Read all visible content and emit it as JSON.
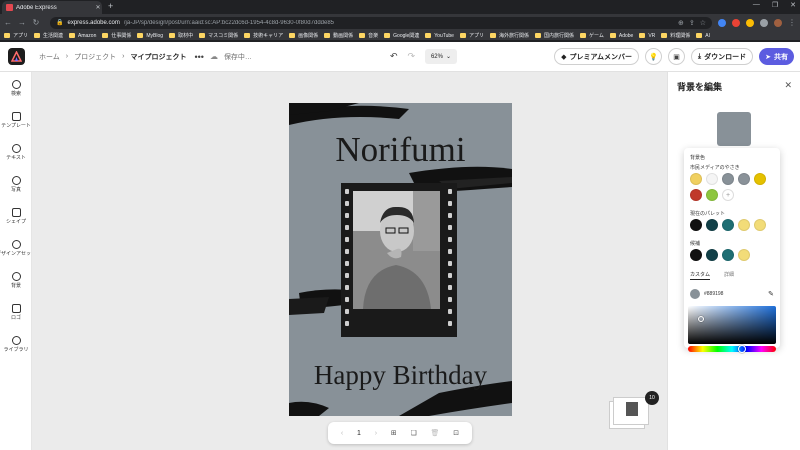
{
  "browser": {
    "tab_title": "Adobe Express",
    "url_host": "express.adobe.com",
    "url_path": "/ja-JP/sp/design/post/urn:aaid:sc:AP:bc22dc6d-1954-4c8d-9630-0f80d7ddde85",
    "bookmarks": [
      "アプリ",
      "生活関連",
      "Amazon",
      "仕事関係",
      "MyBlog",
      "取材中",
      "マスコミ関係",
      "技術キャリア",
      "画像関係",
      "動画関係",
      "音楽",
      "Google関連",
      "YouTube",
      "アプリ",
      "海外旅行関係",
      "国内旅行関係",
      "ゲーム",
      "Adobe",
      "VR",
      "料理関係",
      "AI"
    ]
  },
  "header": {
    "breadcrumb_home": "ホーム",
    "breadcrumb_projects": "プロジェクト",
    "breadcrumb_current": "マイプロジェクト",
    "save_status": "保存中…",
    "zoom": "62%",
    "premium_label": "プレミアムメンバー",
    "download_label": "ダウンロード",
    "share_label": "共有"
  },
  "rail": {
    "items": [
      "検索",
      "テンプレート",
      "テキスト",
      "写真",
      "シェイプ",
      "デザインアセット",
      "背景",
      "ロゴ",
      "ライブラリ"
    ]
  },
  "canvas": {
    "title_text": "Norifumi",
    "bottom_text": "Happy Birthday",
    "page_number": "1",
    "page_count_badge": "10"
  },
  "panel": {
    "title": "背景を編集",
    "bg_color_label": "背景色",
    "recommended_label": "市民メディアのやさき",
    "current_palette_label": "現在のパレット",
    "candidates_label": "候補",
    "tab_custom": "カスタム",
    "tab_detail": "詳細",
    "hex_value": "#889198"
  },
  "colors": {
    "background": "#889198",
    "accent": "#5c5ce0",
    "row1": [
      "#f0d060",
      "#f5f5f5",
      "#889198",
      "#8a9299",
      "#e5c100"
    ],
    "row2": [
      "#c0392b",
      "#8dc63f"
    ],
    "palette": [
      "#111111",
      "#124048",
      "#1e6e73",
      "#f2dc78",
      "#f2dc78"
    ],
    "candidates": [
      "#111111",
      "#124048",
      "#1e6e73",
      "#f2dc78"
    ]
  }
}
